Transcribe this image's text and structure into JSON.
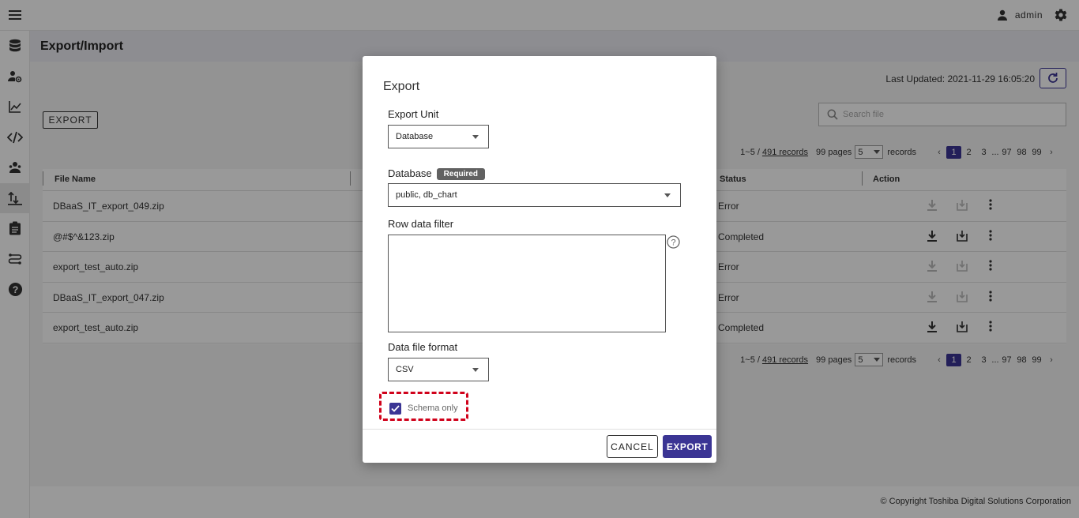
{
  "user": {
    "name": "admin"
  },
  "page": {
    "title": "Export/Import",
    "last_updated": "Last Updated: 2021-11-29 16:05:20"
  },
  "toolbar": {
    "export_label": "EXPORT",
    "search_placeholder": "Search file"
  },
  "pagination": {
    "records_prefix": "1~5 /",
    "records_link": "491 records",
    "pages": "99 pages",
    "page_size": "5",
    "records_label": "records",
    "page_numbers": [
      "1",
      "2",
      "3",
      "97",
      "98",
      "99"
    ],
    "ellipsis": "...",
    "prev": "‹",
    "next": "›"
  },
  "table": {
    "headers": {
      "file_name": "File Name",
      "status": "Status",
      "action": "Action"
    },
    "rows": [
      {
        "file_name": "DBaaS_IT_export_049.zip",
        "status": "Error",
        "enabled": false
      },
      {
        "file_name": "@#$^&123.zip",
        "status": "Completed",
        "enabled": true
      },
      {
        "file_name": "export_test_auto.zip",
        "status": "Error",
        "enabled": false
      },
      {
        "file_name": "DBaaS_IT_export_047.zip",
        "status": "Error",
        "enabled": false
      },
      {
        "file_name": "export_test_auto.zip",
        "status": "Completed",
        "enabled": true
      }
    ]
  },
  "footer": {
    "copyright": "© Copyright Toshiba Digital Solutions Corporation"
  },
  "modal": {
    "title": "Export",
    "export_unit_label": "Export Unit",
    "export_unit_value": "Database",
    "database_label": "Database",
    "required_badge": "Required",
    "database_value": "public, db_chart",
    "row_filter_label": "Row data filter",
    "data_format_label": "Data file format",
    "data_format_value": "CSV",
    "schema_only_label": "Schema only",
    "schema_only_checked": true,
    "cancel_label": "CANCEL",
    "export_label": "EXPORT"
  },
  "colors": {
    "accent": "#3b3594",
    "highlight": "#d0021b",
    "required_badge": "#616161"
  }
}
